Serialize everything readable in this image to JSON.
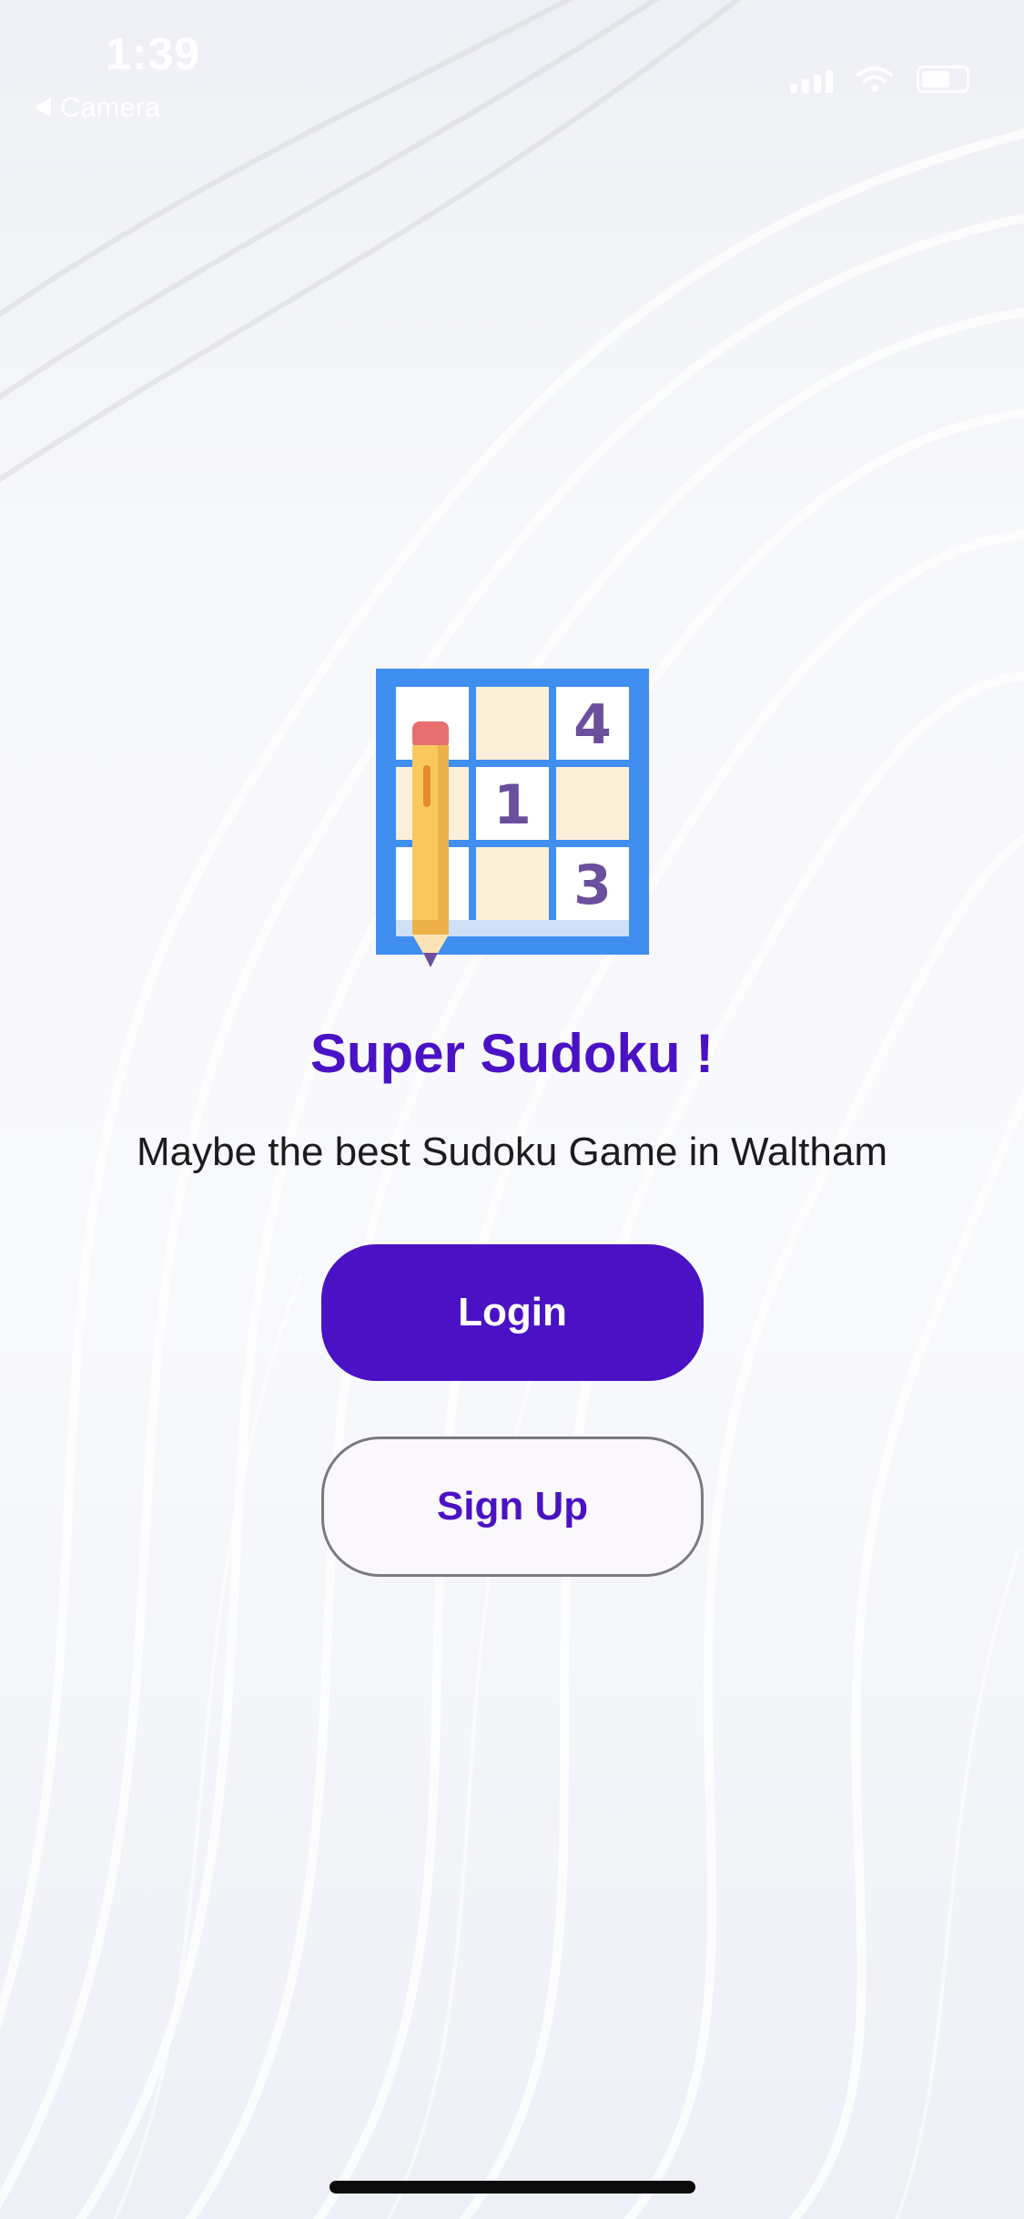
{
  "status_bar": {
    "time": "1:39",
    "back_label": "Camera"
  },
  "logo": {
    "cells": [
      "4",
      "1",
      "3"
    ],
    "icon": "sudoku-pencil-icon"
  },
  "main": {
    "title": "Super Sudoku !",
    "tagline": "Maybe the best Sudoku Game in Waltham"
  },
  "buttons": {
    "login_label": "Login",
    "signup_label": "Sign Up"
  },
  "colors": {
    "accent": "#4a12c4",
    "grid_blue": "#3f8ef0",
    "cell_cream": "#fcefd9",
    "pencil_yellow": "#f9c95e",
    "digit_purple": "#6a4f9c"
  }
}
